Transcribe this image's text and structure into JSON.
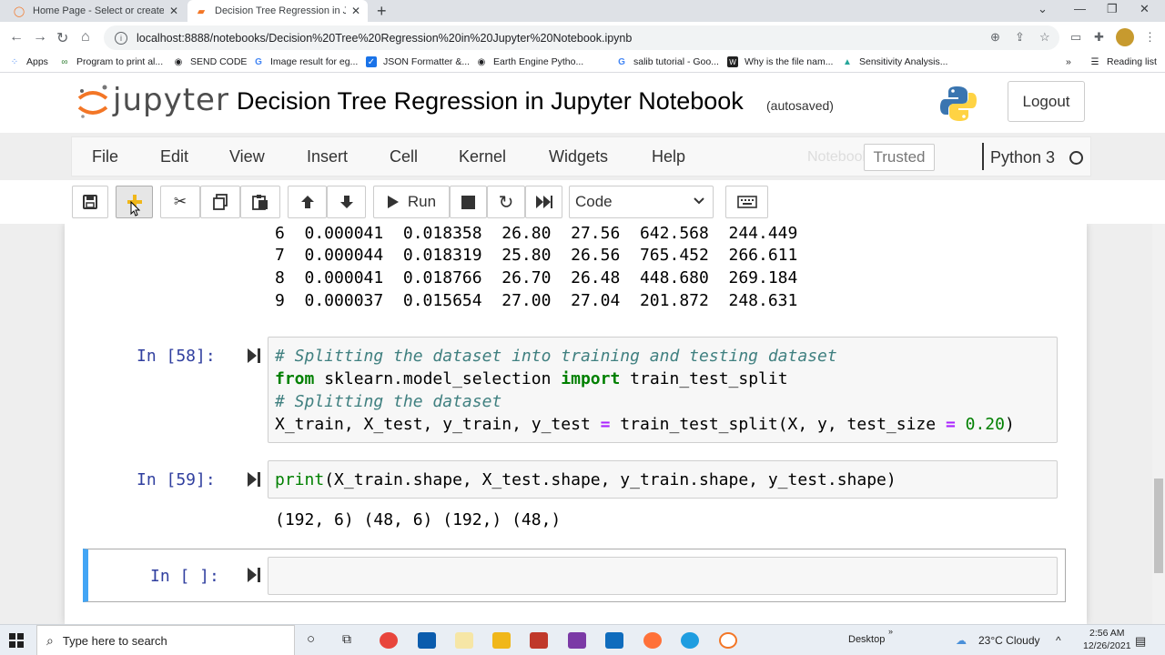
{
  "browser": {
    "tabs": [
      {
        "title": "Home Page - Select or create a n",
        "active": false
      },
      {
        "title": "Decision Tree Regression in Jupy",
        "active": true
      }
    ],
    "url": "localhost:8888/notebooks/Decision%20Tree%20Regression%20in%20Jupyter%20Notebook.ipynb",
    "bookmarks": [
      "Apps",
      "Program to print al...",
      "SEND CODE",
      "Image result for eg...",
      "JSON Formatter &...",
      "Earth Engine Pytho...",
      "salib tutorial - Goo...",
      "Why is the file nam...",
      "Sensitivity Analysis..."
    ],
    "reading_list": "Reading list",
    "overflow": "»"
  },
  "jupyter": {
    "logo_text": "jupyter",
    "notebook_title": "Decision Tree Regression in Jupyter Notebook",
    "autosave": "(autosaved)",
    "logout": "Logout",
    "menu": [
      "File",
      "Edit",
      "View",
      "Insert",
      "Cell",
      "Kernel",
      "Widgets",
      "Help"
    ],
    "notebook_saved": "Notebook saved",
    "trusted": "Trusted",
    "kernel": "Python 3",
    "run_label": "Run",
    "cell_type": "Code"
  },
  "output_rows": [
    "6  0.000041  0.018358  26.80  27.56  642.568  244.449",
    "7  0.000044  0.018319  25.80  26.56  765.452  266.611",
    "8  0.000041  0.018766  26.70  26.48  448.680  269.184",
    "9  0.000037  0.015654  27.00  27.04  201.872  248.631"
  ],
  "cells": {
    "c58": {
      "prompt": "In [58]:",
      "line1": "# Splitting the dataset into training and testing dataset",
      "line2_kw1": "from",
      "line2_mod": " sklearn.model_selection ",
      "line2_kw2": "import",
      "line2_fn": " train_test_split",
      "line3": "# Splitting the dataset",
      "line4_a": "X_train, X_test, y_train, y_test ",
      "line4_eq": "=",
      "line4_b": " train_test_split(X, y, test_size ",
      "line4_eq2": "=",
      "line4_num": " 0.20",
      "line4_c": ")"
    },
    "c59": {
      "prompt": "In [59]:",
      "code_fn": "print",
      "code_rest": "(X_train.shape, X_test.shape, y_train.shape, y_test.shape)",
      "output": "(192, 6) (48, 6) (192,) (48,)"
    },
    "empty": {
      "prompt": "In [ ]:"
    }
  },
  "taskbar": {
    "search_placeholder": "Type here to search",
    "desktop": "Desktop",
    "weather": "23°C  Cloudy",
    "time": "2:56 AM",
    "date": "12/26/2021"
  }
}
